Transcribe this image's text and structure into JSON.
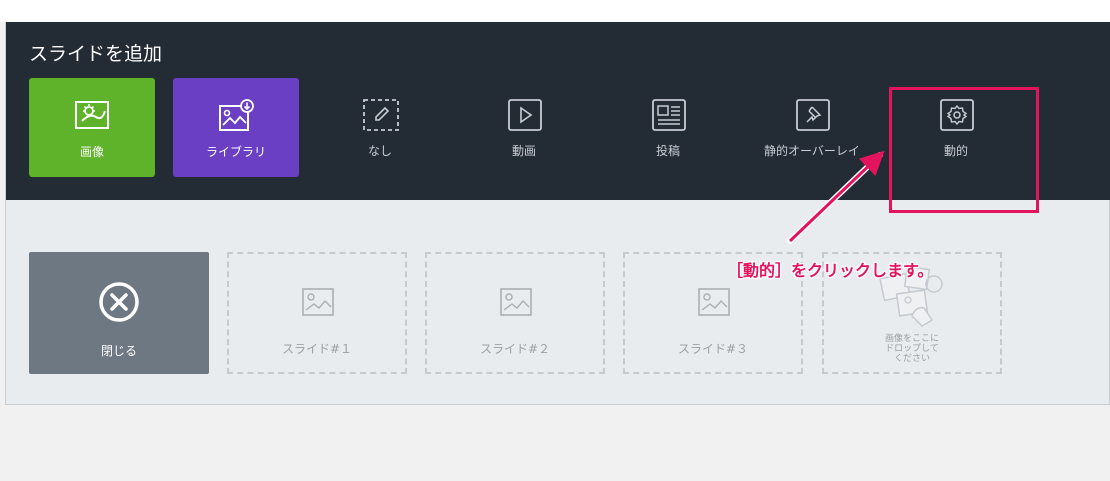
{
  "panel": {
    "title": "スライドを追加",
    "slide_types": [
      {
        "label": "画像",
        "icon": "image-icon",
        "color": "#5fb32a"
      },
      {
        "label": "ライブラリ",
        "icon": "library-icon",
        "color": "#6a3fc4"
      }
    ],
    "options": [
      {
        "label": "なし",
        "icon": "pencil-icon"
      },
      {
        "label": "動画",
        "icon": "video-icon"
      },
      {
        "label": "投稿",
        "icon": "post-icon"
      },
      {
        "label": "静的オーバーレイ",
        "icon": "pin-icon"
      },
      {
        "label": "動的",
        "icon": "gear-icon"
      }
    ]
  },
  "slides": {
    "close_label": "閉じる",
    "items": [
      "スライド#１",
      "スライド#２",
      "スライド#３"
    ],
    "drop_label_lines": [
      "画像をここに",
      "ドロップして",
      "ください"
    ]
  },
  "annotation": {
    "text": "［動的］をクリックします。",
    "color": "#e4135e"
  }
}
